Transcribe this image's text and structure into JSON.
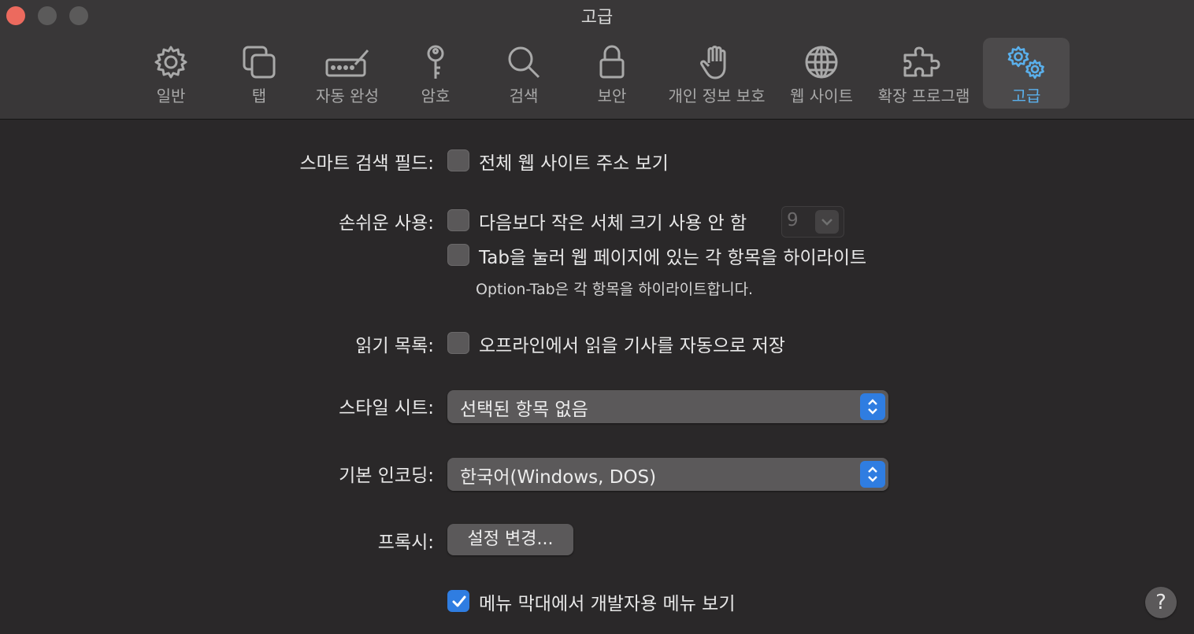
{
  "window": {
    "title": "고급"
  },
  "toolbar": {
    "tabs": [
      {
        "label": "일반",
        "icon": "gear-icon"
      },
      {
        "label": "탭",
        "icon": "tabs-icon"
      },
      {
        "label": "자동 완성",
        "icon": "keyboard-pen-icon"
      },
      {
        "label": "암호",
        "icon": "key-icon"
      },
      {
        "label": "검색",
        "icon": "magnifier-icon"
      },
      {
        "label": "보안",
        "icon": "lock-icon"
      },
      {
        "label": "개인 정보 보호",
        "icon": "hand-icon"
      },
      {
        "label": "웹 사이트",
        "icon": "globe-icon"
      },
      {
        "label": "확장 프로그램",
        "icon": "puzzle-icon"
      },
      {
        "label": "고급",
        "icon": "gears-icon",
        "active": true
      }
    ]
  },
  "settings": {
    "smart_search": {
      "label": "스마트 검색 필드:",
      "option": "전체 웹 사이트 주소 보기",
      "checked": false
    },
    "accessibility": {
      "label": "손쉬운 사용:",
      "option1": "다음보다 작은 서체 크기 사용 안 함",
      "option1_checked": false,
      "font_size": "9",
      "option2": "Tab을 눌러 웹 페이지에 있는 각 항목을 하이라이트",
      "option2_checked": false,
      "hint": "Option-Tab은 각 항목을 하이라이트합니다."
    },
    "reading_list": {
      "label": "읽기 목록:",
      "option": "오프라인에서 읽을 기사를 자동으로 저장",
      "checked": false
    },
    "style_sheet": {
      "label": "스타일 시트:",
      "value": "선택된 항목 없음"
    },
    "encoding": {
      "label": "기본 인코딩:",
      "value": "한국어(Windows, DOS)"
    },
    "proxy": {
      "label": "프록시:",
      "button": "설정 변경..."
    },
    "develop_menu": {
      "option": "메뉴 막대에서 개발자용 메뉴 보기",
      "checked": true
    }
  },
  "help": {
    "label": "?"
  },
  "colors": {
    "accent": "#2f7de1",
    "active_tab": "#5ab0ec",
    "close": "#ec6a5e"
  }
}
